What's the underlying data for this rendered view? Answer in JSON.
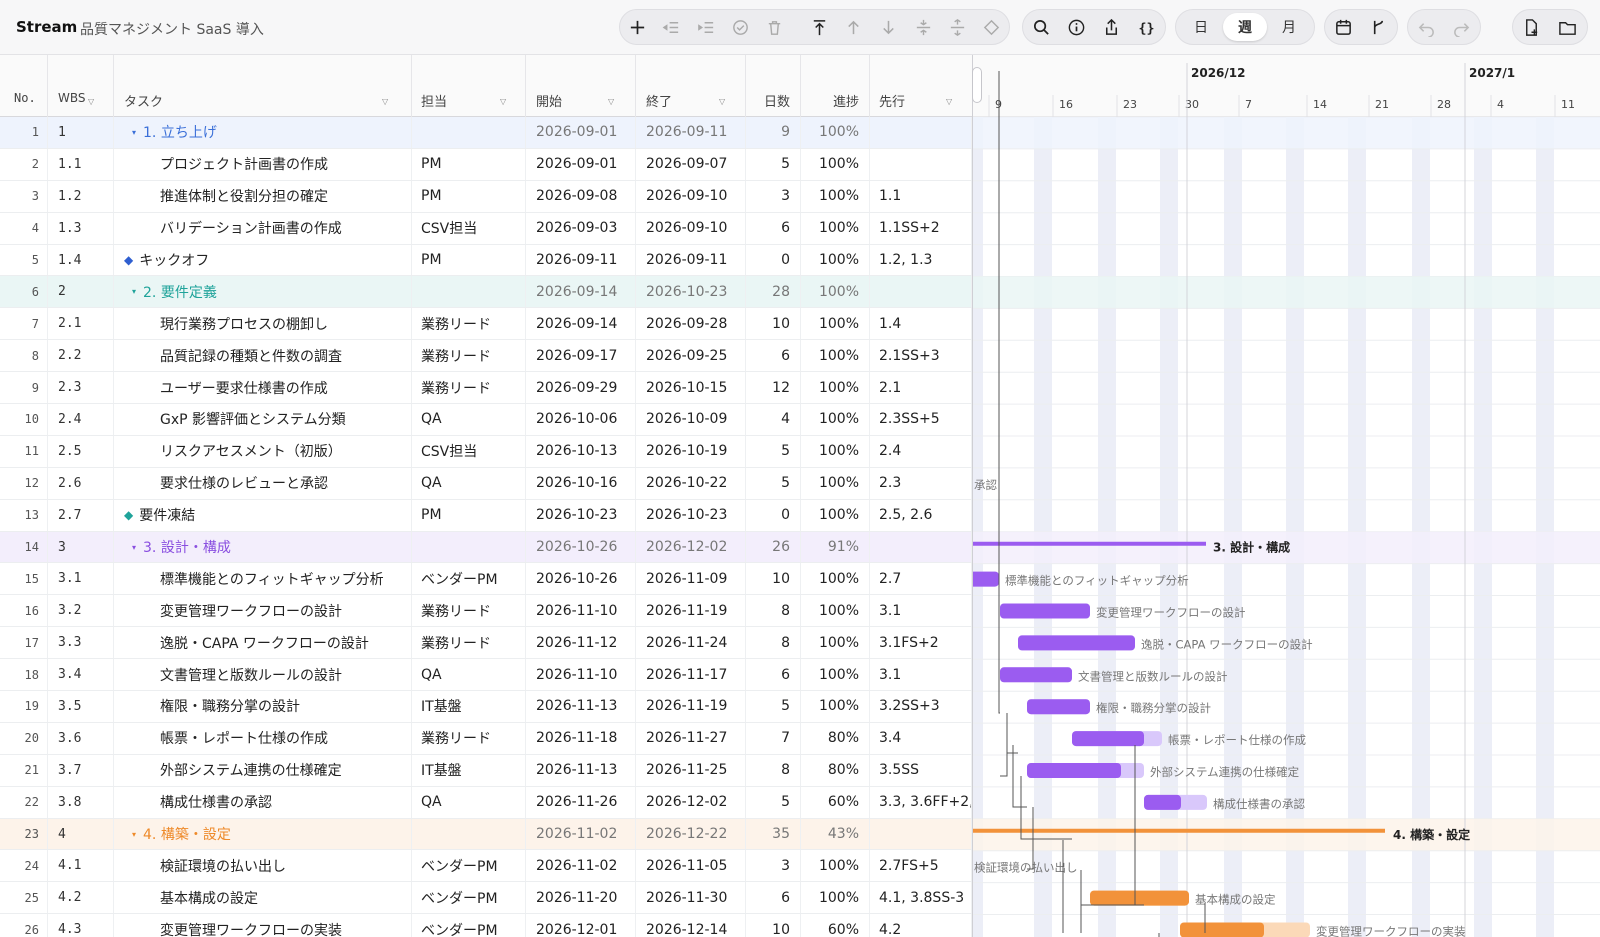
{
  "app": {
    "name": "Stream",
    "project": "品質マネジメント SaaS 導入"
  },
  "toolbar": {
    "icons": [
      "plus-icon",
      "outdent-icon",
      "indent-icon",
      "check-circle-icon",
      "trash-icon",
      "move-top-icon",
      "move-up-icon",
      "move-down-icon",
      "collapse-icon",
      "expand-icon",
      "milestone-icon",
      "search-icon",
      "info-icon",
      "share-icon",
      "json-icon",
      "calendar-icon",
      "branch-icon",
      "undo-icon",
      "redo-icon",
      "new-file-icon",
      "folder-icon"
    ],
    "scale": {
      "day": "日",
      "week": "週",
      "month": "月",
      "active": "週"
    }
  },
  "columns": {
    "no": "No.",
    "wbs": "WBS",
    "task": "タスク",
    "owner": "担当",
    "start": "開始",
    "end": "終了",
    "days": "日数",
    "progress": "進捗",
    "pred": "先行"
  },
  "timeline": {
    "months": [
      {
        "label": "2026/12"
      },
      {
        "label": "2027/1"
      }
    ],
    "days": [
      "9",
      "16",
      "23",
      "30",
      "7",
      "14",
      "21",
      "28",
      "4",
      "11"
    ]
  },
  "rows": [
    {
      "no": "1",
      "wbs": "1",
      "task": "1. 立ち上げ",
      "owner": "",
      "start": "2026-09-01",
      "end": "2026-09-11",
      "days": "9",
      "progress": "100%",
      "pred": "",
      "type": "group",
      "color": "#3a6fd8",
      "bg": "#eef3fd"
    },
    {
      "no": "2",
      "wbs": "1.1",
      "task": "プロジェクト計画書の作成",
      "owner": "PM",
      "start": "2026-09-01",
      "end": "2026-09-07",
      "days": "5",
      "progress": "100%",
      "pred": "",
      "type": "task"
    },
    {
      "no": "3",
      "wbs": "1.2",
      "task": "推進体制と役割分担の確定",
      "owner": "PM",
      "start": "2026-09-08",
      "end": "2026-09-10",
      "days": "3",
      "progress": "100%",
      "pred": "1.1",
      "type": "task"
    },
    {
      "no": "4",
      "wbs": "1.3",
      "task": "バリデーション計画書の作成",
      "owner": "CSV担当",
      "start": "2026-09-03",
      "end": "2026-09-10",
      "days": "6",
      "progress": "100%",
      "pred": "1.1SS+2",
      "type": "task"
    },
    {
      "no": "5",
      "wbs": "1.4",
      "task": "キックオフ",
      "owner": "PM",
      "start": "2026-09-11",
      "end": "2026-09-11",
      "days": "0",
      "progress": "100%",
      "pred": "1.2, 1.3",
      "type": "milestone",
      "color": "#2f5fd0"
    },
    {
      "no": "6",
      "wbs": "2",
      "task": "2. 要件定義",
      "owner": "",
      "start": "2026-09-14",
      "end": "2026-10-23",
      "days": "28",
      "progress": "100%",
      "pred": "",
      "type": "group",
      "color": "#1fa39a",
      "bg": "#eaf6f5"
    },
    {
      "no": "7",
      "wbs": "2.1",
      "task": "現行業務プロセスの棚卸し",
      "owner": "業務リード",
      "start": "2026-09-14",
      "end": "2026-09-28",
      "days": "10",
      "progress": "100%",
      "pred": "1.4",
      "type": "task"
    },
    {
      "no": "8",
      "wbs": "2.2",
      "task": "品質記録の種類と件数の調査",
      "owner": "業務リード",
      "start": "2026-09-17",
      "end": "2026-09-25",
      "days": "6",
      "progress": "100%",
      "pred": "2.1SS+3",
      "type": "task"
    },
    {
      "no": "9",
      "wbs": "2.3",
      "task": "ユーザー要求仕様書の作成",
      "owner": "業務リード",
      "start": "2026-09-29",
      "end": "2026-10-15",
      "days": "12",
      "progress": "100%",
      "pred": "2.1",
      "type": "task"
    },
    {
      "no": "10",
      "wbs": "2.4",
      "task": "GxP 影響評価とシステム分類",
      "owner": "QA",
      "start": "2026-10-06",
      "end": "2026-10-09",
      "days": "4",
      "progress": "100%",
      "pred": "2.3SS+5",
      "type": "task"
    },
    {
      "no": "11",
      "wbs": "2.5",
      "task": "リスクアセスメント（初版）",
      "owner": "CSV担当",
      "start": "2026-10-13",
      "end": "2026-10-19",
      "days": "5",
      "progress": "100%",
      "pred": "2.4",
      "type": "task"
    },
    {
      "no": "12",
      "wbs": "2.6",
      "task": "要求仕様のレビューと承認",
      "owner": "QA",
      "start": "2026-10-16",
      "end": "2026-10-22",
      "days": "5",
      "progress": "100%",
      "pred": "2.3",
      "type": "task"
    },
    {
      "no": "13",
      "wbs": "2.7",
      "task": "要件凍結",
      "owner": "PM",
      "start": "2026-10-23",
      "end": "2026-10-23",
      "days": "0",
      "progress": "100%",
      "pred": "2.5, 2.6",
      "type": "milestone",
      "color": "#1fa39a"
    },
    {
      "no": "14",
      "wbs": "3",
      "task": "3. 設計・構成",
      "owner": "",
      "start": "2026-10-26",
      "end": "2026-12-02",
      "days": "26",
      "progress": "91%",
      "pred": "",
      "type": "group",
      "color": "#8a4fe0",
      "bg": "#f3eefc"
    },
    {
      "no": "15",
      "wbs": "3.1",
      "task": "標準機能とのフィットギャップ分析",
      "owner": "ベンダーPM",
      "start": "2026-10-26",
      "end": "2026-11-09",
      "days": "10",
      "progress": "100%",
      "pred": "2.7",
      "type": "task"
    },
    {
      "no": "16",
      "wbs": "3.2",
      "task": "変更管理ワークフローの設計",
      "owner": "業務リード",
      "start": "2026-11-10",
      "end": "2026-11-19",
      "days": "8",
      "progress": "100%",
      "pred": "3.1",
      "type": "task"
    },
    {
      "no": "17",
      "wbs": "3.3",
      "task": "逸脱・CAPA ワークフローの設計",
      "owner": "業務リード",
      "start": "2026-11-12",
      "end": "2026-11-24",
      "days": "8",
      "progress": "100%",
      "pred": "3.1FS+2",
      "type": "task"
    },
    {
      "no": "18",
      "wbs": "3.4",
      "task": "文書管理と版数ルールの設計",
      "owner": "QA",
      "start": "2026-11-10",
      "end": "2026-11-17",
      "days": "6",
      "progress": "100%",
      "pred": "3.1",
      "type": "task"
    },
    {
      "no": "19",
      "wbs": "3.5",
      "task": "権限・職務分掌の設計",
      "owner": "IT基盤",
      "start": "2026-11-13",
      "end": "2026-11-19",
      "days": "5",
      "progress": "100%",
      "pred": "3.2SS+3",
      "type": "task"
    },
    {
      "no": "20",
      "wbs": "3.6",
      "task": "帳票・レポート仕様の作成",
      "owner": "業務リード",
      "start": "2026-11-18",
      "end": "2026-11-27",
      "days": "7",
      "progress": "80%",
      "pred": "3.4",
      "type": "task"
    },
    {
      "no": "21",
      "wbs": "3.7",
      "task": "外部システム連携の仕様確定",
      "owner": "IT基盤",
      "start": "2026-11-13",
      "end": "2026-11-25",
      "days": "8",
      "progress": "80%",
      "pred": "3.5SS",
      "type": "task"
    },
    {
      "no": "22",
      "wbs": "3.8",
      "task": "構成仕様書の承認",
      "owner": "QA",
      "start": "2026-11-26",
      "end": "2026-12-02",
      "days": "5",
      "progress": "60%",
      "pred": "3.3, 3.6FF+2,",
      "type": "task"
    },
    {
      "no": "23",
      "wbs": "4",
      "task": "4. 構築・設定",
      "owner": "",
      "start": "2026-11-02",
      "end": "2026-12-22",
      "days": "35",
      "progress": "43%",
      "pred": "",
      "type": "group",
      "color": "#ee8a2a",
      "bg": "#fdf3ea"
    },
    {
      "no": "24",
      "wbs": "4.1",
      "task": "検証環境の払い出し",
      "owner": "ベンダーPM",
      "start": "2026-11-02",
      "end": "2026-11-05",
      "days": "3",
      "progress": "100%",
      "pred": "2.7FS+5",
      "type": "task"
    },
    {
      "no": "25",
      "wbs": "4.2",
      "task": "基本構成の設定",
      "owner": "ベンダーPM",
      "start": "2026-11-20",
      "end": "2026-11-30",
      "days": "6",
      "progress": "100%",
      "pred": "4.1, 3.8SS-3",
      "type": "task"
    },
    {
      "no": "26",
      "wbs": "4.3",
      "task": "変更管理ワークフローの実装",
      "owner": "ベンダーPM",
      "start": "2026-12-01",
      "end": "2026-12-14",
      "days": "10",
      "progress": "60%",
      "pred": "4.2",
      "type": "task"
    }
  ],
  "gantt_labels": {
    "row12": "承認",
    "row14": "3. 設計・構成",
    "row23": "4. 構築・設定",
    "row24": "検証環境の払い出し"
  },
  "colors": {
    "purple": "#9b5cf0",
    "purple_light": "#d9c8fb",
    "orange": "#f2923a",
    "orange_light": "#fbd9b8",
    "weekend": "#eceef7"
  }
}
